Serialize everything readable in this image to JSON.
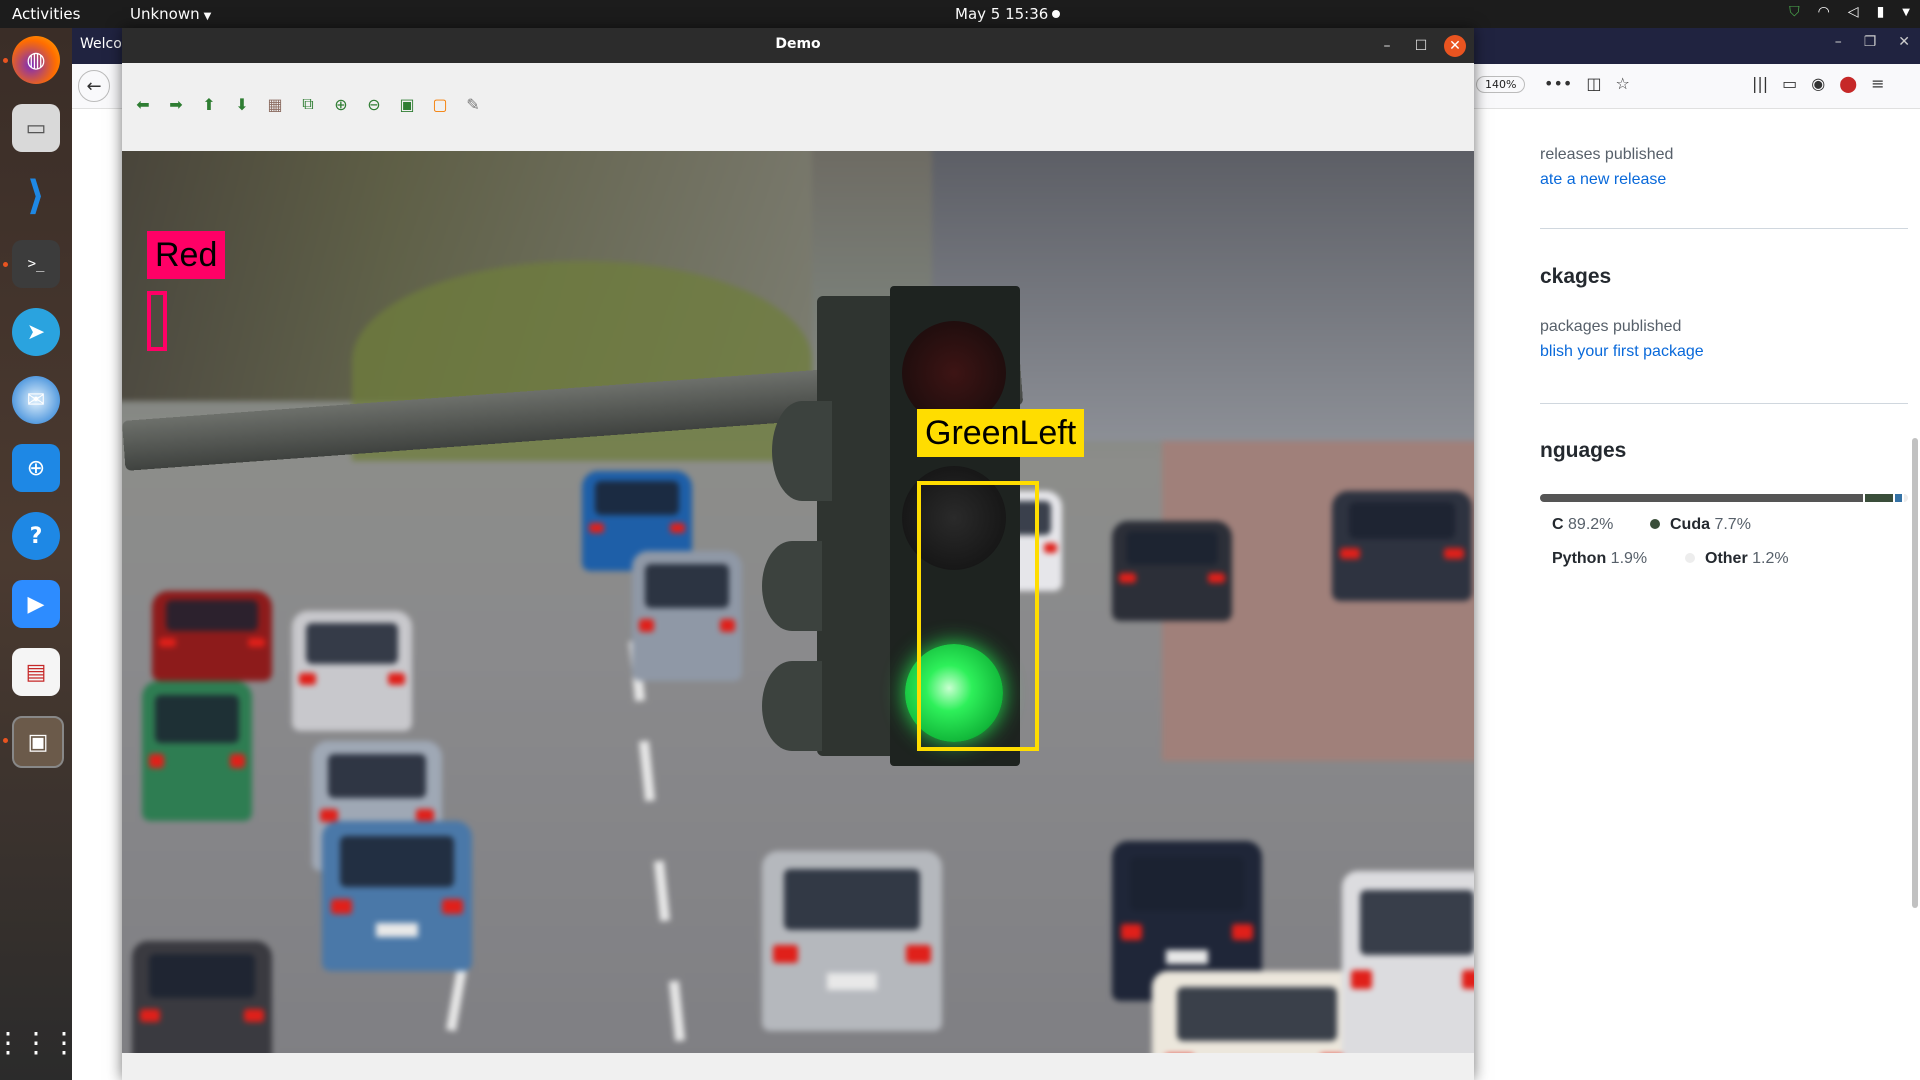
{
  "topbar": {
    "activities": "Activities",
    "app_menu": "Unknown",
    "clock": "May 5  15:36"
  },
  "dock": {
    "apps": [
      "firefox-icon",
      "files-icon",
      "vscode-icon",
      "terminal-icon",
      "telegram-icon",
      "thunderbird-icon",
      "software-icon",
      "help-icon",
      "zoom-icon",
      "reader-icon",
      "image-viewer-icon"
    ],
    "show_apps_icon": "grid-icon"
  },
  "browser": {
    "tab_title": "Welco",
    "zoom": "140%",
    "sidebar": {
      "releases_text": "releases published",
      "releases_link": "ate a new release",
      "packages_heading": "ckages",
      "packages_text": "packages published",
      "packages_link": "blish your first package",
      "languages_heading": "nguages",
      "languages": [
        {
          "name": "C",
          "pct": "89.2%",
          "color": "#555555"
        },
        {
          "name": "Cuda",
          "pct": "7.7%",
          "color": "#3A4E3A"
        },
        {
          "name": "Python",
          "pct": "1.9%",
          "color": "#3572A5"
        },
        {
          "name": "Other",
          "pct": "1.2%",
          "color": "#ededed"
        }
      ]
    }
  },
  "demo": {
    "title": "Demo",
    "toolbar_icons": [
      "arrow-left-icon",
      "arrow-right-icon",
      "arrow-up-icon",
      "arrow-down-icon",
      "image-icon",
      "fit-icon",
      "zoom-in-icon",
      "zoom-out-icon",
      "save-icon",
      "copy-icon",
      "settings-icon"
    ],
    "detections": [
      {
        "label": "Red",
        "color": "#ff0066"
      },
      {
        "label": "GreenLeft",
        "color": "#ffdd00"
      }
    ]
  }
}
